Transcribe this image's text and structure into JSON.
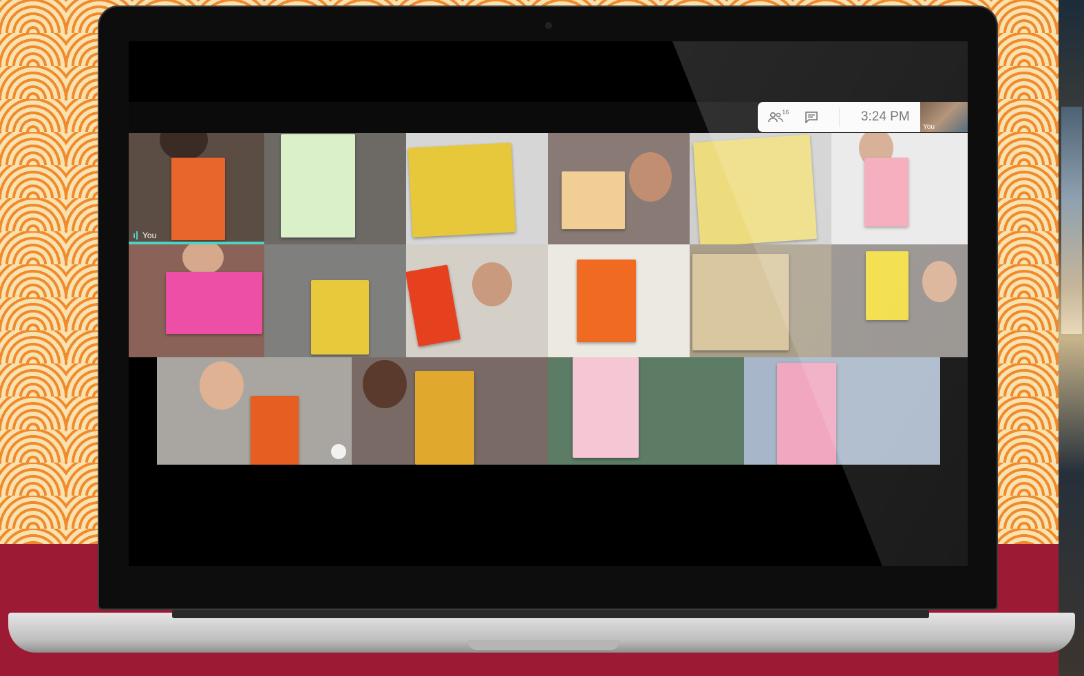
{
  "meeting": {
    "participant_count": "16",
    "time": "3:24 PM",
    "self_label": "You",
    "tile_self_label": "You"
  },
  "icons": {
    "people": "people-icon",
    "chat": "chat-icon",
    "audio": "audio-level-icon",
    "mic": "mic-icon"
  },
  "colors": {
    "speaking_indicator": "#4fd1c5",
    "background_red": "#9c1a33",
    "background_orange": "#f08a2c"
  }
}
